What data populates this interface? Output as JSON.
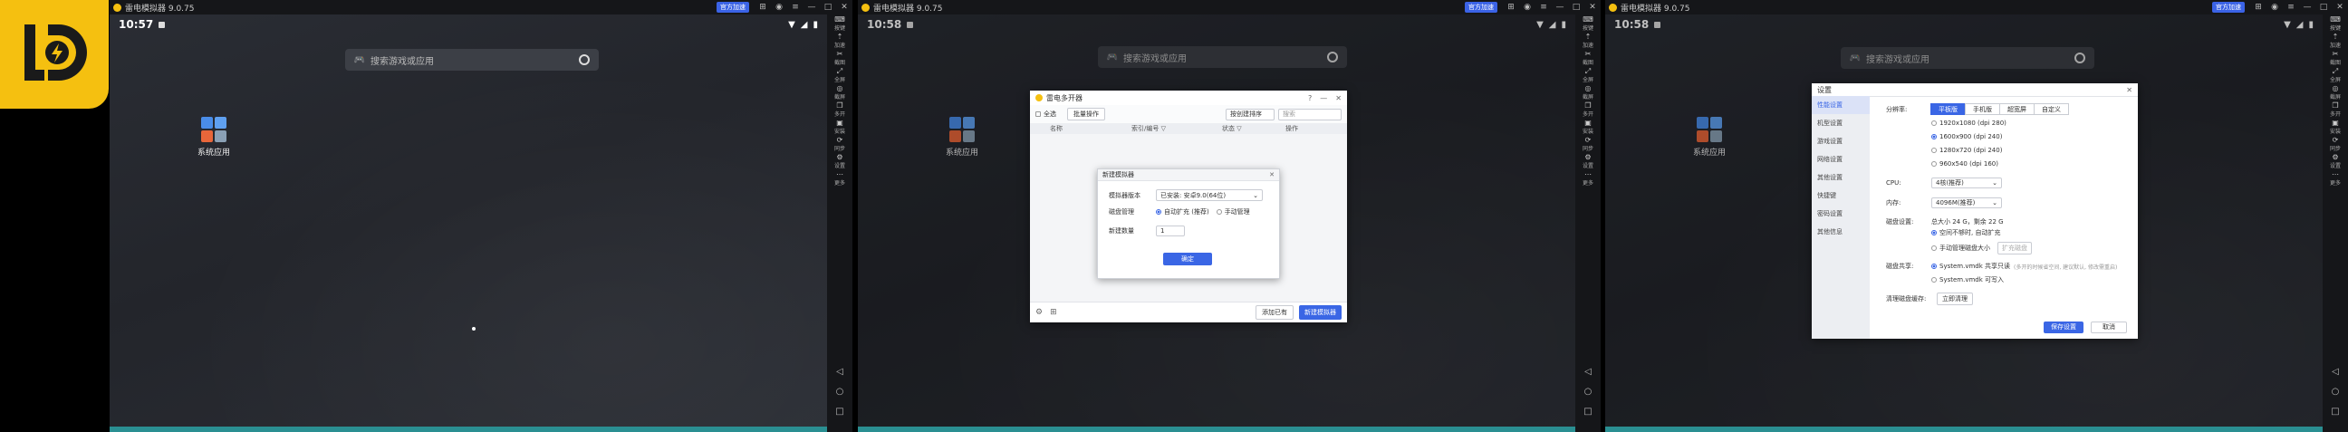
{
  "app": {
    "title": "雷电模拟器 9.0.75",
    "badge": "官方加速"
  },
  "status": {
    "time_1": "10:57",
    "time_2": "10:58",
    "time_3": "10:58"
  },
  "search": {
    "placeholder": "搜索游戏或应用"
  },
  "folder": {
    "label": "系统应用"
  },
  "sidebar": {
    "items": [
      {
        "label": "按键"
      },
      {
        "label": "加速"
      },
      {
        "label": "截图"
      },
      {
        "label": "全屏"
      },
      {
        "label": "截屏"
      },
      {
        "label": "多开"
      },
      {
        "label": "安装"
      },
      {
        "label": "同步"
      },
      {
        "label": "设置"
      },
      {
        "label": "更多"
      }
    ],
    "nav": [
      "◁",
      "○",
      "□"
    ]
  },
  "multi": {
    "title": "雷电多开器",
    "select_all": "全选",
    "batch": "批量操作",
    "sort": "按创建排序",
    "search_placeholder": "搜索",
    "columns": [
      "名称",
      "索引/编号 ▽",
      "状态 ▽",
      "操作"
    ],
    "add_existing": "添加已有",
    "new_emulator": "新建模拟器"
  },
  "new_dialog": {
    "title": "新建模拟器",
    "version_label": "模拟器版本",
    "version_value": "已安装: 安卓9.0(64位)",
    "disk_label": "磁盘管理",
    "disk_auto": "自动扩充 (推荐)",
    "disk_manual": "手动管理",
    "count_label": "新建数量",
    "count_value": "1",
    "confirm": "确定"
  },
  "settings": {
    "title": "设置",
    "tabs": [
      "性能设置",
      "机型设置",
      "游戏设置",
      "网络设置",
      "其他设置",
      "快捷键",
      "密码设置",
      "其他信息"
    ],
    "resolution_label": "分辨率:",
    "resolution_modes": [
      "平板版",
      "手机版",
      "超宽屏",
      "自定义"
    ],
    "resolution_options": [
      "1920x1080 (dpi 280)",
      "1600x900 (dpi 240)",
      "1280x720 (dpi 240)",
      "960x540 (dpi 160)"
    ],
    "cpu_label": "CPU:",
    "cpu_value": "4核(推荐)",
    "mem_label": "内存:",
    "mem_value": "4096M(推荐)",
    "disk_label": "磁盘设置:",
    "disk_info": "总大小 24 G，剩余 22 G",
    "disk_auto": "空间不够时, 自动扩充",
    "disk_manual": "手动管理磁盘大小",
    "disk_expand": "扩充磁盘",
    "share_label": "磁盘共享:",
    "share_opt1": "System.vmdk 共享只读",
    "share_opt1_note": "(多开的时候省空间, 建议默认, 修改需重启)",
    "share_opt2": "System.vmdk 可写入",
    "clean_label": "清理磁盘缓存:",
    "clean_button": "立即清理",
    "save": "保存设置",
    "cancel": "取消"
  },
  "colors": {
    "accent": "#3a66e5",
    "logo": "#f5c010",
    "strip": "#2a8f92"
  }
}
